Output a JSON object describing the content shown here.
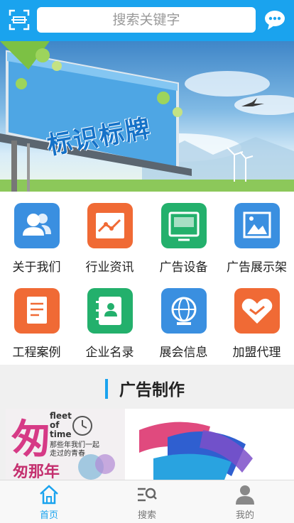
{
  "header": {
    "search_placeholder": "搜索关键字",
    "scan_icon": "scan-icon",
    "message_icon": "chat-bubble-icon",
    "color": "#1aa3ee"
  },
  "banner": {
    "text": "标识标牌",
    "slide_count": 4
  },
  "categories": [
    {
      "label": "关于我们",
      "icon": "users-icon",
      "color": "#3a8fe0"
    },
    {
      "label": "行业资讯",
      "icon": "trend-chart-icon",
      "color": "#f06a35"
    },
    {
      "label": "广告设备",
      "icon": "monitor-icon",
      "color": "#23b06c"
    },
    {
      "label": "广告展示架",
      "icon": "picture-frame-icon",
      "color": "#3a8fe0"
    },
    {
      "label": "工程案例",
      "icon": "document-icon",
      "color": "#f06a35"
    },
    {
      "label": "企业名录",
      "icon": "address-book-icon",
      "color": "#23b06c"
    },
    {
      "label": "展会信息",
      "icon": "globe-icon",
      "color": "#3a8fe0"
    },
    {
      "label": "加盟代理",
      "icon": "handshake-icon",
      "color": "#f06a35"
    }
  ],
  "section": {
    "title": "广告制作",
    "card1": {
      "line1": "fleet",
      "line2": "of",
      "line3": "time",
      "line4": "那些年我们一起",
      "line5": "走过的青春",
      "big": "匆",
      "bottom": "匆那年"
    }
  },
  "nav": [
    {
      "label": "首页",
      "icon": "home-icon",
      "active": true
    },
    {
      "label": "搜索",
      "icon": "search-list-icon",
      "active": false
    },
    {
      "label": "我的",
      "icon": "user-icon",
      "active": false
    }
  ]
}
